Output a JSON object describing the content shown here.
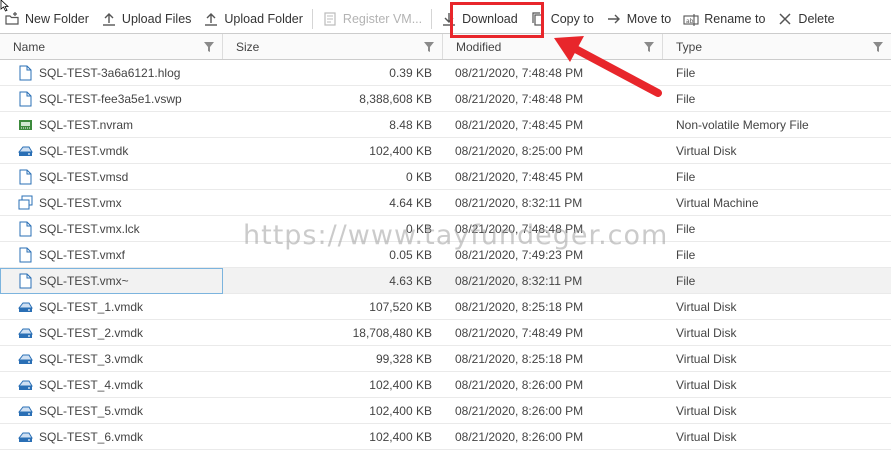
{
  "toolbar": {
    "new_folder": "New Folder",
    "upload_files": "Upload Files",
    "upload_folder": "Upload Folder",
    "register_vm": "Register VM...",
    "download": "Download",
    "copy_to": "Copy to",
    "move_to": "Move to",
    "rename_to": "Rename to",
    "delete": "Delete"
  },
  "columns": {
    "name": "Name",
    "size": "Size",
    "modified": "Modified",
    "type": "Type"
  },
  "files": [
    {
      "name": "SQL-TEST-3a6a6121.hlog",
      "size": "0.39 KB",
      "modified": "08/21/2020, 7:48:48 PM",
      "type": "File",
      "icon": "file-icon"
    },
    {
      "name": "SQL-TEST-fee3a5e1.vswp",
      "size": "8,388,608 KB",
      "modified": "08/21/2020, 7:48:48 PM",
      "type": "File",
      "icon": "file-icon"
    },
    {
      "name": "SQL-TEST.nvram",
      "size": "8.48 KB",
      "modified": "08/21/2020, 7:48:45 PM",
      "type": "Non-volatile Memory File",
      "icon": "nvram-icon"
    },
    {
      "name": "SQL-TEST.vmdk",
      "size": "102,400 KB",
      "modified": "08/21/2020, 8:25:00 PM",
      "type": "Virtual Disk",
      "icon": "disk-icon"
    },
    {
      "name": "SQL-TEST.vmsd",
      "size": "0 KB",
      "modified": "08/21/2020, 7:48:45 PM",
      "type": "File",
      "icon": "file-icon"
    },
    {
      "name": "SQL-TEST.vmx",
      "size": "4.64 KB",
      "modified": "08/21/2020, 8:32:11 PM",
      "type": "Virtual Machine",
      "icon": "vm-icon"
    },
    {
      "name": "SQL-TEST.vmx.lck",
      "size": "0 KB",
      "modified": "08/21/2020, 7:48:48 PM",
      "type": "File",
      "icon": "file-icon"
    },
    {
      "name": "SQL-TEST.vmxf",
      "size": "0.05 KB",
      "modified": "08/21/2020, 7:49:23 PM",
      "type": "File",
      "icon": "file-icon"
    },
    {
      "name": "SQL-TEST.vmx~",
      "size": "4.63 KB",
      "modified": "08/21/2020, 8:32:11 PM",
      "type": "File",
      "icon": "file-icon",
      "selected": true
    },
    {
      "name": "SQL-TEST_1.vmdk",
      "size": "107,520 KB",
      "modified": "08/21/2020, 8:25:18 PM",
      "type": "Virtual Disk",
      "icon": "disk-icon"
    },
    {
      "name": "SQL-TEST_2.vmdk",
      "size": "18,708,480 KB",
      "modified": "08/21/2020, 7:48:49 PM",
      "type": "Virtual Disk",
      "icon": "disk-icon"
    },
    {
      "name": "SQL-TEST_3.vmdk",
      "size": "99,328 KB",
      "modified": "08/21/2020, 8:25:18 PM",
      "type": "Virtual Disk",
      "icon": "disk-icon"
    },
    {
      "name": "SQL-TEST_4.vmdk",
      "size": "102,400 KB",
      "modified": "08/21/2020, 8:26:00 PM",
      "type": "Virtual Disk",
      "icon": "disk-icon"
    },
    {
      "name": "SQL-TEST_5.vmdk",
      "size": "102,400 KB",
      "modified": "08/21/2020, 8:26:00 PM",
      "type": "Virtual Disk",
      "icon": "disk-icon"
    },
    {
      "name": "SQL-TEST_6.vmdk",
      "size": "102,400 KB",
      "modified": "08/21/2020, 8:26:00 PM",
      "type": "Virtual Disk",
      "icon": "disk-icon"
    }
  ],
  "watermark": "https://www.tayfundeger.com",
  "colors": {
    "highlight": "#e8262b",
    "selected_outline": "#7cb4de",
    "icon_blue": "#2a6fb5",
    "icon_green": "#3c8a3c"
  }
}
